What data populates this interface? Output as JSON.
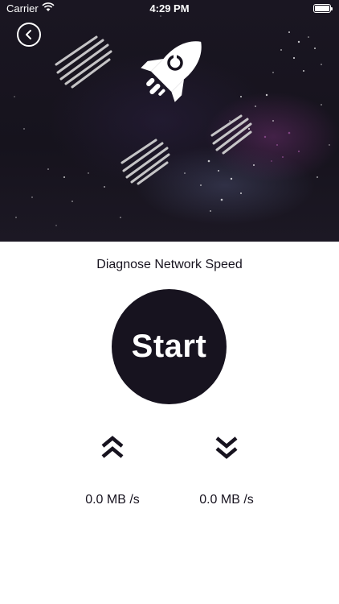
{
  "status_bar": {
    "carrier": "Carrier",
    "time": "4:29 PM",
    "icons": [
      "wifi-icon",
      "battery-icon"
    ]
  },
  "header": {
    "back_icon": "chevron-left-icon",
    "hero_icon": "rocket-icon"
  },
  "main": {
    "title": "Diagnose Network Speed",
    "start_label": "Start",
    "upload": {
      "icon": "double-chevron-up-icon",
      "value": "0.0 MB /s"
    },
    "download": {
      "icon": "double-chevron-down-icon",
      "value": "0.0 MB /s"
    }
  },
  "colors": {
    "primary": "#17131f",
    "background": "#ffffff",
    "hero_background": "#1a1622"
  }
}
